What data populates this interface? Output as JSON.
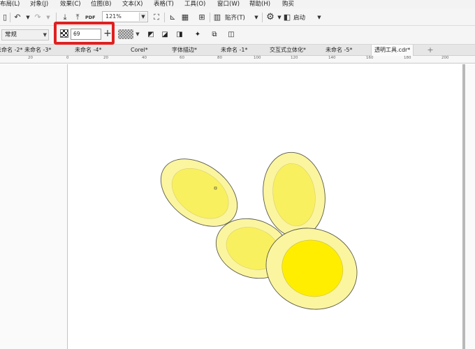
{
  "menu": {
    "items": [
      "布局(L)",
      "对象(J)",
      "效果(C)",
      "位图(B)",
      "文本(X)",
      "表格(T)",
      "工具(O)",
      "窗口(W)",
      "帮助(H)",
      "购买"
    ]
  },
  "toolbar": {
    "pdf_label": "PDF",
    "zoom": "121%",
    "snap_label": "贴齐(T)",
    "launch_label": "启动"
  },
  "property_bar": {
    "merge_mode": "常规",
    "transparency_value": "69"
  },
  "tabs": [
    "未命名 -2*",
    "未命名 -3*",
    "未命名 -4*",
    "Corel*",
    "字体描边*",
    "未命名 -1*",
    "交互式立体化*",
    "未命名 -5*",
    "透明工具.cdr*"
  ],
  "active_tab_index": 8,
  "ruler": {
    "labels": [
      "20",
      "0",
      "20",
      "40",
      "60",
      "80",
      "100",
      "120",
      "140",
      "160",
      "180",
      "200"
    ]
  },
  "drawing": {
    "outer_fill": "#fbf5a0",
    "inner_fill": "#f9f060",
    "bright_fill": "#ffee00",
    "stroke": "#5a5a4a"
  }
}
